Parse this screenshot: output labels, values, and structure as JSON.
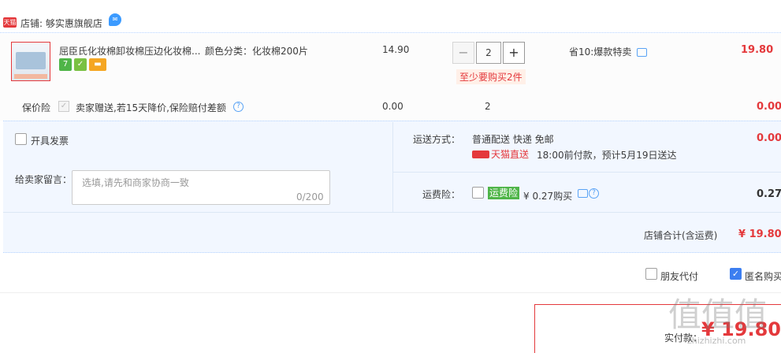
{
  "shop": {
    "badge": "天猫",
    "label": "店铺: 够实惠旗舰店",
    "chat_icon": "chat-bubble-icon"
  },
  "item": {
    "title": "屈臣氏化妆棉卸妆棉压边化妆棉...",
    "color": "颜色分类：化妆棉200片",
    "icons": [
      "7",
      "✓",
      "▬"
    ],
    "price": "14.90",
    "quantity": "2",
    "min_tip": "至少要购买2件",
    "promo": "省10:爆款特卖",
    "subtotal": "19.80"
  },
  "insurance": {
    "label": "保价险",
    "desc": "卖家赠送,若15天降价,保险赔付差额",
    "price": "0.00",
    "qty": "2",
    "subtotal": "0.00"
  },
  "invoice": {
    "label": "开具发票"
  },
  "message": {
    "label": "给卖家留言：",
    "placeholder": "选填,请先和商家协商一致",
    "count": "0/200"
  },
  "shipping": {
    "label": "运送方式：",
    "value": "普通配送 快递 免邮",
    "logo": "天猫直送",
    "eta": "18:00前付款，预计5月19日送达",
    "fee": "0.00"
  },
  "freight_insurance": {
    "label": "运费险：",
    "badge": "运费险",
    "price": "¥ 0.27购买",
    "amount": "0.27"
  },
  "total": {
    "label": "店铺合计(含运费)",
    "amount": "¥ 19.80"
  },
  "options": {
    "friend_pay": "朋友代付",
    "anonymous": "匿名购买"
  },
  "pay": {
    "label": "实付款：",
    "amount": "¥ 19.80"
  },
  "watermark": {
    "main": "值值值",
    "sub": "zhizhizhi.com"
  },
  "colors": {
    "accent": "#e4393c",
    "blue": "#3c7ef0",
    "panel": "#f2f7ff"
  }
}
